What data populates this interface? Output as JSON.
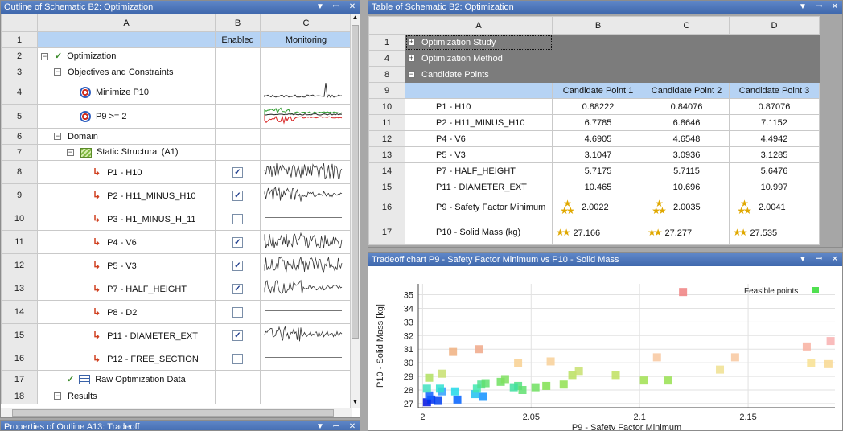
{
  "outline": {
    "title": "Outline of Schematic B2: Optimization",
    "columns": [
      "A",
      "B",
      "C"
    ],
    "header_row": {
      "num": "1",
      "enabled": "Enabled",
      "monitoring": "Monitoring"
    },
    "rows": [
      {
        "num": "2",
        "label": "Optimization",
        "indent": 0,
        "icon": "check-icon",
        "expander": "minus",
        "enabled": null,
        "monitor": null
      },
      {
        "num": "3",
        "label": "Objectives and Constraints",
        "indent": 1,
        "icon": null,
        "expander": "minus",
        "enabled": null,
        "monitor": null
      },
      {
        "num": "4",
        "label": "Minimize P10",
        "indent": 3,
        "icon": "target-icon",
        "expander": null,
        "enabled": null,
        "monitor": "spike"
      },
      {
        "num": "5",
        "label": "P9 >= 2",
        "indent": 3,
        "icon": "target-icon",
        "expander": null,
        "enabled": null,
        "monitor": "redgreen"
      },
      {
        "num": "6",
        "label": "Domain",
        "indent": 1,
        "icon": null,
        "expander": "minus",
        "enabled": null,
        "monitor": null
      },
      {
        "num": "7",
        "label": "Static Structural (A1)",
        "indent": 2,
        "icon": "static-structural-icon",
        "expander": "minus",
        "enabled": null,
        "monitor": null
      },
      {
        "num": "8",
        "label": "P1 - H10",
        "indent": 4,
        "icon": "parameter-icon",
        "expander": null,
        "enabled": true,
        "monitor": "noise"
      },
      {
        "num": "9",
        "label": "P2 - H11_MINUS_H10",
        "indent": 4,
        "icon": "parameter-icon",
        "expander": null,
        "enabled": true,
        "monitor": "decay"
      },
      {
        "num": "10",
        "label": "P3 - H1_MINUS_H_11",
        "indent": 4,
        "icon": "parameter-icon",
        "expander": null,
        "enabled": false,
        "monitor": "flat"
      },
      {
        "num": "11",
        "label": "P4 - V6",
        "indent": 4,
        "icon": "parameter-icon",
        "expander": null,
        "enabled": true,
        "monitor": "noise"
      },
      {
        "num": "12",
        "label": "P5 - V3",
        "indent": 4,
        "icon": "parameter-icon",
        "expander": null,
        "enabled": true,
        "monitor": "noise"
      },
      {
        "num": "13",
        "label": "P7 - HALF_HEIGHT",
        "indent": 4,
        "icon": "parameter-icon",
        "expander": null,
        "enabled": true,
        "monitor": "decay"
      },
      {
        "num": "14",
        "label": "P8 - D2",
        "indent": 4,
        "icon": "parameter-icon",
        "expander": null,
        "enabled": false,
        "monitor": "flat"
      },
      {
        "num": "15",
        "label": "P11 - DIAMETER_EXT",
        "indent": 4,
        "icon": "parameter-icon",
        "expander": null,
        "enabled": true,
        "monitor": "decay"
      },
      {
        "num": "16",
        "label": "P12 - FREE_SECTION",
        "indent": 4,
        "icon": "parameter-icon",
        "expander": null,
        "enabled": false,
        "monitor": "flat"
      },
      {
        "num": "17",
        "label": "Raw Optimization Data",
        "indent": 2,
        "icon": "table-icon",
        "expander": null,
        "enabled": null,
        "monitor": null
      },
      {
        "num": "18",
        "label": "Results",
        "indent": 1,
        "icon": null,
        "expander": "minus",
        "enabled": null,
        "monitor": null
      }
    ]
  },
  "properties": {
    "title": "Properties of Outline A13: Tradeoff"
  },
  "table": {
    "title": "Table of Schematic B2: Optimization",
    "columns": [
      "A",
      "B",
      "C",
      "D"
    ],
    "groups": [
      {
        "num": "1",
        "label": "Optimization Study",
        "expander": "plus"
      },
      {
        "num": "4",
        "label": "Optimization Method",
        "expander": "plus"
      },
      {
        "num": "8",
        "label": "Candidate Points",
        "expander": "minus"
      }
    ],
    "candidate_header": {
      "num": "9",
      "cols": [
        "Candidate Point 1",
        "Candidate Point 2",
        "Candidate Point 3"
      ]
    },
    "rows": [
      {
        "num": "10",
        "label": "P1 - H10",
        "values": [
          "0.88222",
          "0.84076",
          "0.87076"
        ],
        "stars": null
      },
      {
        "num": "11",
        "label": "P2 - H11_MINUS_H10",
        "values": [
          "6.7785",
          "6.8646",
          "7.1152"
        ],
        "stars": null
      },
      {
        "num": "12",
        "label": "P4 - V6",
        "values": [
          "4.6905",
          "4.6548",
          "4.4942"
        ],
        "stars": null
      },
      {
        "num": "13",
        "label": "P5 - V3",
        "values": [
          "3.1047",
          "3.0936",
          "3.1285"
        ],
        "stars": null
      },
      {
        "num": "14",
        "label": "P7 - HALF_HEIGHT",
        "values": [
          "5.7175",
          "5.7115",
          "5.6476"
        ],
        "stars": null
      },
      {
        "num": "15",
        "label": "P11 - DIAMETER_EXT",
        "values": [
          "10.465",
          "10.696",
          "10.997"
        ],
        "stars": null
      },
      {
        "num": "16",
        "label": "P9 - Safety Factor Minimum",
        "values": [
          "2.0022",
          "2.0035",
          "2.0041"
        ],
        "stars": 3
      },
      {
        "num": "17",
        "label": "P10 - Solid Mass (kg)",
        "values": [
          "27.166",
          "27.277",
          "27.535"
        ],
        "stars": 2
      }
    ]
  },
  "chart": {
    "title": "Tradeoff chart P9 - Safety Factor Minimum vs P10 - Solid Mass"
  },
  "chart_data": {
    "type": "scatter",
    "xlabel": "P9 - Safety Factor Minimum",
    "ylabel": "P10 - Solid Mass  [kg]",
    "xlim": [
      1.998,
      2.19
    ],
    "ylim": [
      26.7,
      35.8
    ],
    "xticks": [
      "2",
      "2.05",
      "2.1",
      "2.15"
    ],
    "xtick_values": [
      2.0,
      2.05,
      2.1,
      2.15
    ],
    "yticks": [
      "27",
      "28",
      "29",
      "30",
      "31",
      "32",
      "33",
      "34",
      "35"
    ],
    "ytick_values": [
      27,
      28,
      29,
      30,
      31,
      32,
      33,
      34,
      35
    ],
    "legend": "Feasible points",
    "legend_color": "#50e050",
    "points": [
      {
        "x": 2.002,
        "y": 27.1,
        "c": "#0010e0"
      },
      {
        "x": 2.004,
        "y": 27.3,
        "c": "#0030f0"
      },
      {
        "x": 2.007,
        "y": 27.2,
        "c": "#0040f0"
      },
      {
        "x": 2.003,
        "y": 27.6,
        "c": "#1060ff"
      },
      {
        "x": 2.016,
        "y": 27.3,
        "c": "#0060ff"
      },
      {
        "x": 2.028,
        "y": 27.5,
        "c": "#1090ff"
      },
      {
        "x": 2.009,
        "y": 27.9,
        "c": "#30a0ff"
      },
      {
        "x": 2.024,
        "y": 27.7,
        "c": "#20c0f0"
      },
      {
        "x": 2.015,
        "y": 27.9,
        "c": "#20d8e8"
      },
      {
        "x": 2.002,
        "y": 28.1,
        "c": "#40e0c0"
      },
      {
        "x": 2.008,
        "y": 28.1,
        "c": "#30e0d0"
      },
      {
        "x": 2.025,
        "y": 28.1,
        "c": "#40e8b0"
      },
      {
        "x": 2.027,
        "y": 28.4,
        "c": "#50e090"
      },
      {
        "x": 2.029,
        "y": 28.5,
        "c": "#60e070"
      },
      {
        "x": 2.036,
        "y": 28.6,
        "c": "#70e060"
      },
      {
        "x": 2.038,
        "y": 28.8,
        "c": "#80e060"
      },
      {
        "x": 2.044,
        "y": 28.3,
        "c": "#50e080"
      },
      {
        "x": 2.046,
        "y": 28.0,
        "c": "#60e070"
      },
      {
        "x": 2.042,
        "y": 28.2,
        "c": "#40e0a0"
      },
      {
        "x": 2.052,
        "y": 28.2,
        "c": "#70e060"
      },
      {
        "x": 2.057,
        "y": 28.3,
        "c": "#80e050"
      },
      {
        "x": 2.065,
        "y": 28.4,
        "c": "#90e050"
      },
      {
        "x": 2.069,
        "y": 29.1,
        "c": "#b8e060"
      },
      {
        "x": 2.072,
        "y": 29.4,
        "c": "#c8e070"
      },
      {
        "x": 2.089,
        "y": 29.1,
        "c": "#c0e060"
      },
      {
        "x": 2.102,
        "y": 28.7,
        "c": "#a0e050"
      },
      {
        "x": 2.113,
        "y": 28.7,
        "c": "#98e050"
      },
      {
        "x": 2.003,
        "y": 28.9,
        "c": "#b0e060"
      },
      {
        "x": 2.009,
        "y": 29.2,
        "c": "#c8e070"
      },
      {
        "x": 2.014,
        "y": 30.8,
        "c": "#f0b080"
      },
      {
        "x": 2.026,
        "y": 31.0,
        "c": "#f0a888"
      },
      {
        "x": 2.044,
        "y": 30.0,
        "c": "#f8d090"
      },
      {
        "x": 2.059,
        "y": 30.1,
        "c": "#f8d098"
      },
      {
        "x": 2.108,
        "y": 30.4,
        "c": "#f8c8a0"
      },
      {
        "x": 2.137,
        "y": 29.5,
        "c": "#f0e090"
      },
      {
        "x": 2.144,
        "y": 30.4,
        "c": "#f8c8a0"
      },
      {
        "x": 2.12,
        "y": 35.2,
        "c": "#f08080"
      },
      {
        "x": 2.177,
        "y": 31.2,
        "c": "#f8b0a0"
      },
      {
        "x": 2.179,
        "y": 30.0,
        "c": "#f8e090"
      },
      {
        "x": 2.187,
        "y": 29.9,
        "c": "#f8d890"
      },
      {
        "x": 2.188,
        "y": 31.6,
        "c": "#f8b0b0"
      }
    ]
  }
}
